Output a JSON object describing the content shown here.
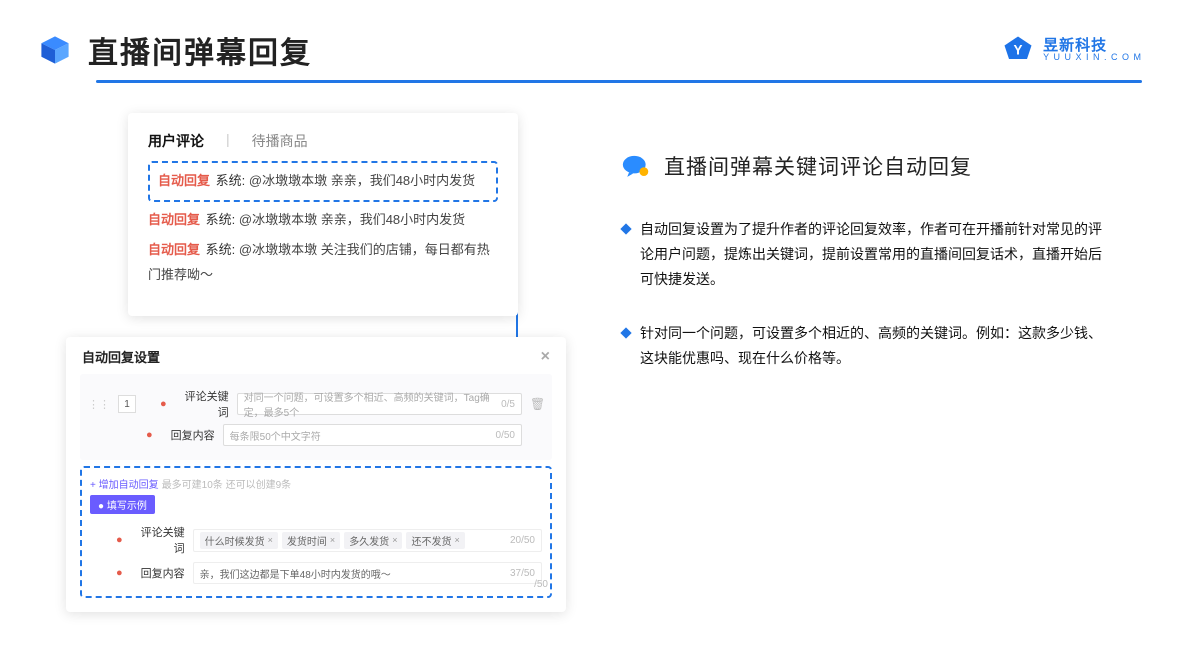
{
  "header": {
    "title": "直播间弹幕回复",
    "brand_cn": "昱新科技",
    "brand_en": "Y U U X I N . C O M"
  },
  "comment_card": {
    "tab_active": "用户评论",
    "tab_inactive": "待播商品",
    "rows": {
      "badge": "自动回复",
      "sys": "系统:",
      "r1": "@冰墩墩本墩 亲亲，我们48小时内发货",
      "r2": "@冰墩墩本墩 亲亲，我们48小时内发货",
      "r3": "@冰墩墩本墩 关注我们的店铺，每日都有热门推荐呦～"
    }
  },
  "settings": {
    "title": "自动回复设置",
    "index": "1",
    "field1_label": "评论关键词",
    "field1_placeholder": "对同一个问题，可设置多个相近、高频的关键词，Tag确定，最多5个",
    "field1_count": "0/5",
    "field2_label": "回复内容",
    "field2_placeholder": "每条限50个中文字符",
    "field2_count": "0/50",
    "add_link": "+ 增加自动回复",
    "add_hint": "最多可建10条 还可以创建9条",
    "example_badge": "● 填写示例",
    "ex_field1_label": "评论关键词",
    "ex_tags": [
      "什么时候发货",
      "发货时间",
      "多久发货",
      "还不发货"
    ],
    "ex_field1_count": "20/50",
    "ex_field2_label": "回复内容",
    "ex_field2_value": "亲，我们这边都是下单48小时内发货的哦～",
    "ex_field2_count": "37/50",
    "outer_count": "/50"
  },
  "right": {
    "section_title": "直播间弹幕关键词评论自动回复",
    "bullet1": "自动回复设置为了提升作者的评论回复效率，作者可在开播前针对常见的评论用户问题，提炼出关键词，提前设置常用的直播间回复话术，直播开始后可快捷发送。",
    "bullet2": "针对同一个问题，可设置多个相近的、高频的关键词。例如：这款多少钱、这块能优惠吗、现在什么价格等。"
  }
}
